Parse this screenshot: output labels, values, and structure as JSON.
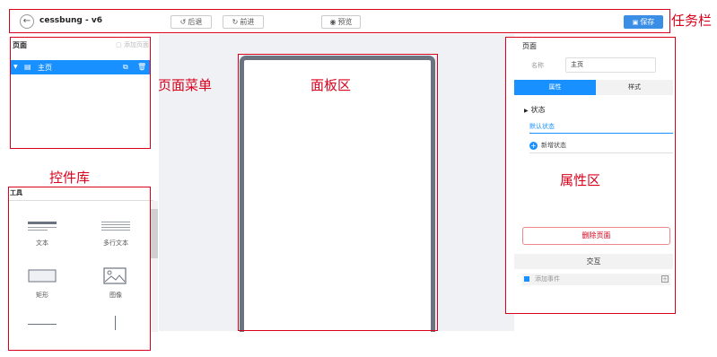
{
  "topbar": {
    "title": "cessbung - v6",
    "back_label": "←",
    "undo_label": "后退",
    "redo_label": "前进",
    "preview_label": "预览",
    "save_label": "保存"
  },
  "pages_panel": {
    "title": "页面",
    "add_page_label": "添加页面",
    "pages": [
      {
        "label": "主页",
        "selected": true
      }
    ]
  },
  "library": {
    "title": "工具",
    "tools": [
      {
        "label": "文本"
      },
      {
        "label": "多行文本"
      },
      {
        "label": "矩形"
      },
      {
        "label": "图像"
      }
    ]
  },
  "properties": {
    "title": "页面",
    "name_label": "名称",
    "name_value": "主页",
    "tab_attr": "属性",
    "tab_style": "样式",
    "state_header": "状态",
    "default_state": "默认状态",
    "new_state": "新增状态",
    "delete_page": "删除页面",
    "interaction": "交互",
    "add_event": "添加事件"
  },
  "annotations": {
    "taskbar": "任务栏",
    "page_menu": "页面菜单",
    "panel_area": "面板区",
    "widget_library": "控件库",
    "property_area": "属性区"
  },
  "colors": {
    "accent": "#1890ff",
    "annotation": "#d9001b",
    "canvas_bg": "#f0f1f4"
  }
}
